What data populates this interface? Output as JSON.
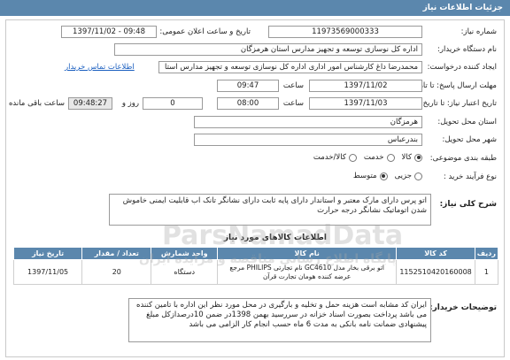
{
  "header": {
    "title": "جزئیات اطلاعات نیاز"
  },
  "fields": {
    "need_number_label": "شماره نیاز:",
    "need_number": "11973569000333",
    "announce_label": "تاریخ و ساعت اعلان عمومی:",
    "announce_value": "1397/11/02 - 09:48",
    "buyer_label": "نام دستگاه خریدار:",
    "buyer_value": "اداره کل نوسازی توسعه و تجهیز مدارس استان هرمزگان",
    "creator_label": "ایجاد کننده درخواست:",
    "creator_value": "محمدرضا داغ کارشناس امور اداری اداره کل نوسازی توسعه و تجهیز مدارس استا",
    "contact_link": "اطلاعات تماس خریدار",
    "reply_deadline_label": "مهلت ارسال پاسخ: تا تاریخ:",
    "reply_date": "1397/11/02",
    "time_label": "ساعت",
    "reply_time": "09:47",
    "validity_label": "تاریخ اعتبار نیاز: تا تاریخ:",
    "validity_date": "1397/11/03",
    "validity_time": "08:00",
    "days_value": "0",
    "days_label": "روز و",
    "remaining_value": "09:48:27",
    "remaining_label": "ساعت باقی مانده",
    "province_label": "استان محل تحویل:",
    "province_value": "هرمزگان",
    "city_label": "شهر محل تحویل:",
    "city_value": "بندرعباس",
    "category_label": "طبقه بندی موضوعی:",
    "category_options": [
      "کالا",
      "خدمت",
      "کالا/خدمت"
    ],
    "purchase_type_label": "نوع فرآیند خرید :",
    "purchase_options": [
      "جزیی",
      "متوسط"
    ]
  },
  "description": {
    "label": "شرح کلی نیاز:",
    "text": "اتو پرس دارای مارک معتبر و استاندار دارای پایه ثابت دارای نشانگر تانک اب قابلیت ایمنی خاموش شدن اتوماتیک نشانگر درجه حرارت"
  },
  "goods": {
    "title": "اطلاعات کالاهای مورد نیاز",
    "columns": [
      "ردیف",
      "کد کالا",
      "نام کالا",
      "واحد شمارش",
      "تعداد / مقدار",
      "تاریخ نیاز"
    ],
    "rows": [
      [
        "1",
        "1152510420160008",
        "اتو برقی بخار مدل GC4610 نام تجارتی PHILIPS مرجع عرضه کننده هومان تجارت قرآن",
        "دستگاه",
        "20",
        "1397/11/05"
      ]
    ]
  },
  "buyer_notes": {
    "label": "توضیحات خریدار:",
    "text": "ایران کد مشابه است هزینه حمل و تخلیه و بارگیری در محل مورد نظر این اداره با تامین کننده می باشد پرداخت بصورت اسناد خزانه در سررسید بهمن 1398در ضمن 10درصدازکل مبلغ پیشنهادی ضمانت نامه بانکی به مدت 6 ماه حسب انجام کار الزامی می باشد"
  },
  "watermark": {
    "line1": "ParsNamadData",
    "line2": "پایگاه اطلاع رسانی مناقصه و مزایده ایران"
  }
}
